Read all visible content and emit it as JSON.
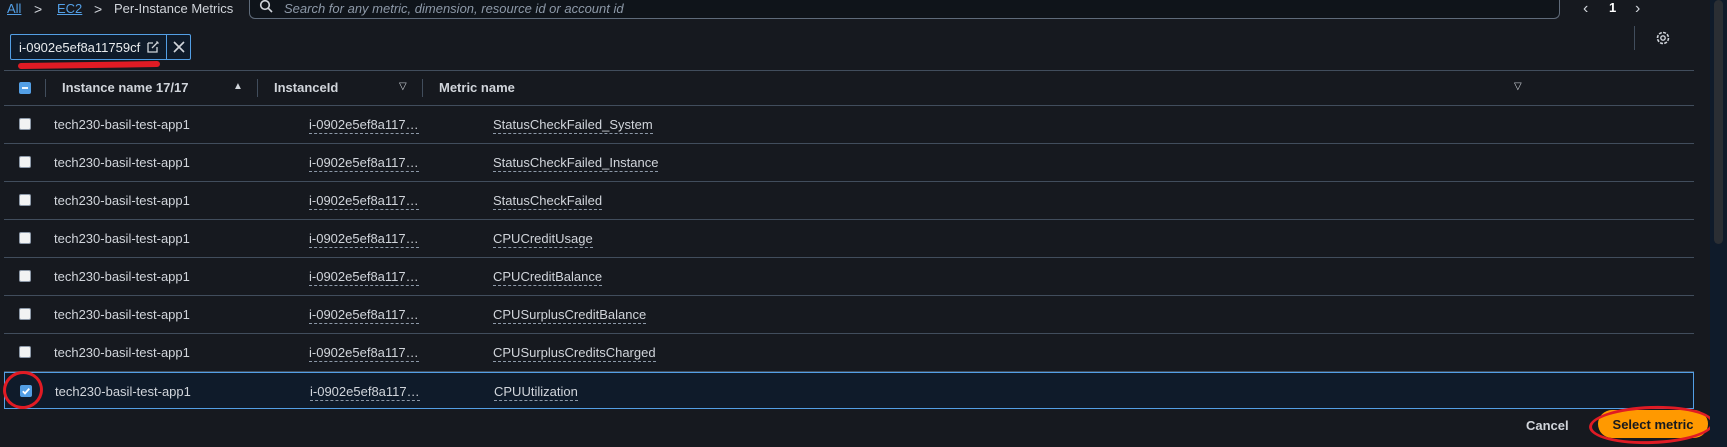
{
  "breadcrumb": {
    "all": "All",
    "sep": ">",
    "ec2": "EC2",
    "page": "Per-Instance Metrics"
  },
  "search": {
    "placeholder": "Search for any metric, dimension, resource id or account id"
  },
  "pagination": {
    "current_page": "1"
  },
  "filter_token": {
    "value": "i-0902e5ef8a11759cf"
  },
  "columns": [
    {
      "label": "Instance name 17/17"
    },
    {
      "label": "InstanceId"
    },
    {
      "label": "Metric name"
    }
  ],
  "rows": [
    {
      "instance_name": "tech230-basil-test-app1",
      "instance_id": "i-0902e5ef8a117…",
      "metric": "StatusCheckFailed_System",
      "checked": false
    },
    {
      "instance_name": "tech230-basil-test-app1",
      "instance_id": "i-0902e5ef8a117…",
      "metric": "StatusCheckFailed_Instance",
      "checked": false
    },
    {
      "instance_name": "tech230-basil-test-app1",
      "instance_id": "i-0902e5ef8a117…",
      "metric": "StatusCheckFailed",
      "checked": false
    },
    {
      "instance_name": "tech230-basil-test-app1",
      "instance_id": "i-0902e5ef8a117…",
      "metric": "CPUCreditUsage",
      "checked": false
    },
    {
      "instance_name": "tech230-basil-test-app1",
      "instance_id": "i-0902e5ef8a117…",
      "metric": "CPUCreditBalance",
      "checked": false
    },
    {
      "instance_name": "tech230-basil-test-app1",
      "instance_id": "i-0902e5ef8a117…",
      "metric": "CPUSurplusCreditBalance",
      "checked": false
    },
    {
      "instance_name": "tech230-basil-test-app1",
      "instance_id": "i-0902e5ef8a117…",
      "metric": "CPUSurplusCreditsCharged",
      "checked": false
    },
    {
      "instance_name": "tech230-basil-test-app1",
      "instance_id": "i-0902e5ef8a117…",
      "metric": "CPUUtilization",
      "checked": true
    }
  ],
  "footer": {
    "cancel": "Cancel",
    "select": "Select metric"
  },
  "colors": {
    "accent": "#539fe5",
    "primary_button": "#ff9900",
    "annotation": "#e01b24",
    "background": "#16191f"
  }
}
